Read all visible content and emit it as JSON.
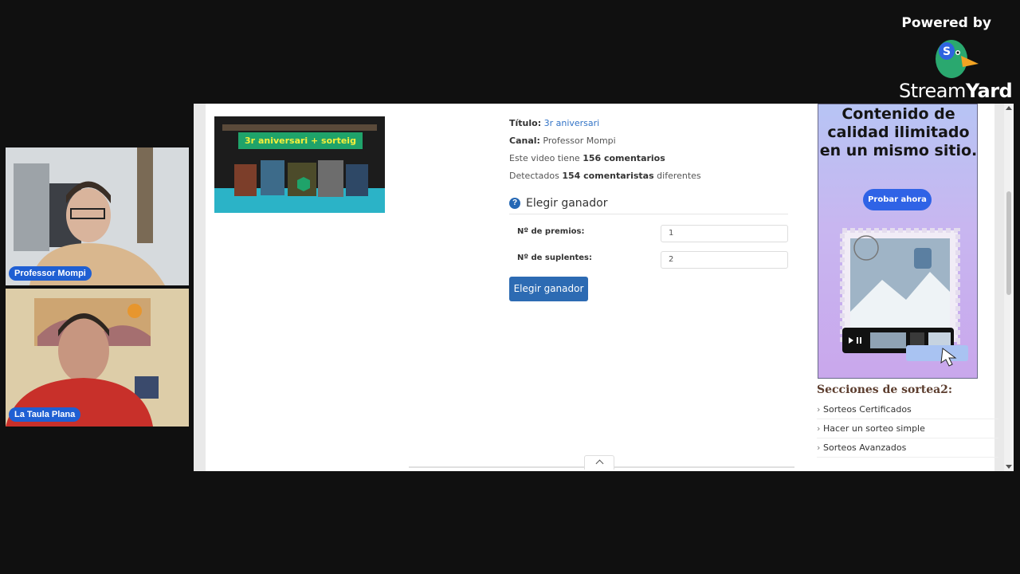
{
  "branding": {
    "powered_by": "Powered by",
    "logo_stream": "Stream",
    "logo_yard": "Yard"
  },
  "participants": [
    {
      "name": "Professor Mompi"
    },
    {
      "name": "La Taula Plana"
    }
  ],
  "video": {
    "thumbnail_text": "3r aniversari + sorteig",
    "title_label": "Título:",
    "title_value": "3r aniversari",
    "channel_label": "Canal:",
    "channel_value": "Professor Mompi",
    "comments_prefix": "Este video tiene",
    "comments_count": "156 comentarios",
    "commenters_prefix": "Detectados",
    "commenters_count": "154 comentaristas",
    "commenters_suffix": "diferentes"
  },
  "winner": {
    "section_title": "Elegir ganador",
    "prizes_label": "Nº de premios:",
    "prizes_value": "1",
    "alternates_label": "Nº de suplentes:",
    "alternates_value": "2",
    "button_label": "Elegir ganador"
  },
  "ad": {
    "headline": "Contenido de calidad ilimitado en un mismo sitio.",
    "cta": "Probar ahora"
  },
  "sidebar": {
    "title": "Secciones de sortea2:",
    "items": [
      "Sorteos Certificados",
      "Hacer un sorteo simple",
      "Sorteos Avanzados"
    ]
  },
  "colors": {
    "link": "#3273c6",
    "button": "#2d6bb3",
    "name_tag": "#1f5fd3"
  }
}
